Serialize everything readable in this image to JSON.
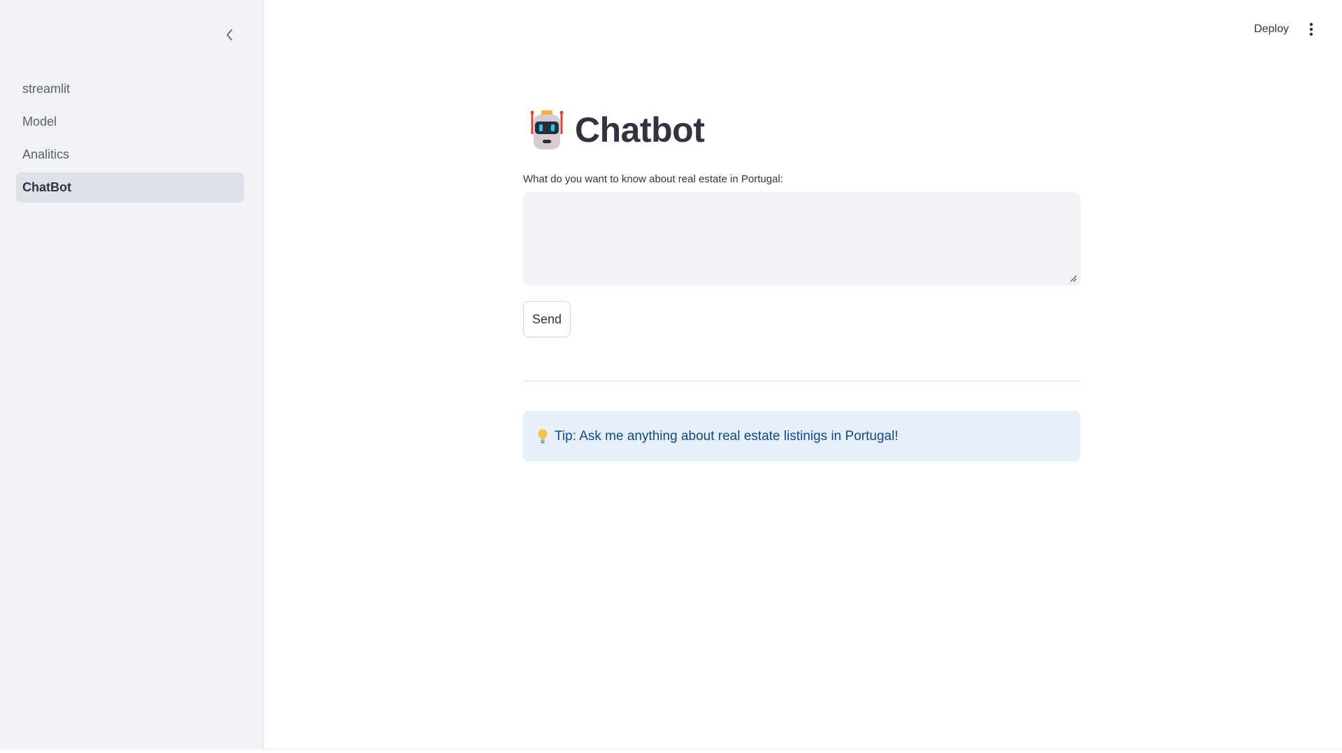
{
  "header": {
    "deploy_label": "Deploy"
  },
  "sidebar": {
    "items": [
      {
        "label": "streamlit",
        "active": false
      },
      {
        "label": "Model",
        "active": false
      },
      {
        "label": "Analitics",
        "active": false
      },
      {
        "label": "ChatBot",
        "active": true
      }
    ]
  },
  "main": {
    "title": "Chatbot",
    "title_icon": "robot-icon",
    "question_label": "What do you want to know about real estate in Portugal:",
    "question_value": "",
    "send_label": "Send",
    "tip_icon": "lightbulb-icon",
    "tip_text": "Tip: Ask me anything about real estate listinigs in Portugal!"
  },
  "colors": {
    "sidebar_bg": "#f0f2f6",
    "active_item_bg": "#dde1e8",
    "input_bg": "#f0f2f6",
    "tip_bg": "#e7f0fa",
    "tip_text": "#0f4a86",
    "text": "#31333f"
  }
}
